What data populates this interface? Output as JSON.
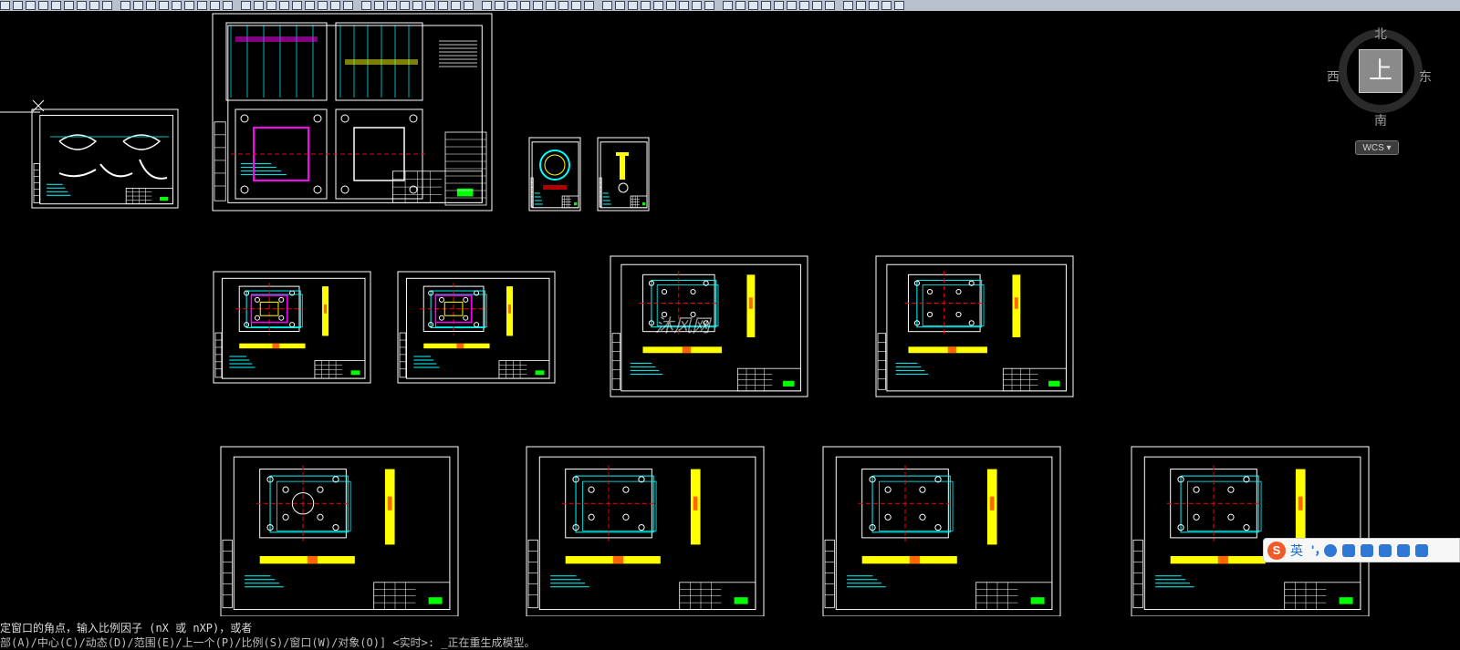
{
  "toolbar": {
    "icon_count": 68,
    "icon_names": [
      "line-icon",
      "polyline-icon",
      "polygon-icon",
      "rectangle-icon",
      "arc-icon",
      "circle-icon",
      "spline-icon",
      "ellipse-icon",
      "insert-block-icon",
      "hatch-icon",
      "text-icon",
      "move-icon",
      "copy-icon",
      "rotate-icon",
      "scale-icon",
      "trim-icon",
      "extend-icon",
      "fillet-icon",
      "layer-icon",
      "properties-icon",
      "zoom-icon",
      "pan-icon"
    ]
  },
  "viewcube": {
    "north": "北",
    "south": "南",
    "west": "西",
    "east": "东",
    "face": "上",
    "wcs_label": "WCS"
  },
  "command_line": {
    "line1": "定窗口的角点，输入比例因子 (nX 或 nXP)，或者",
    "line2": "部(A)/中心(C)/动态(D)/范围(E)/上一个(P)/比例(S)/窗口(W)/对象(O)] <实时>: _正在重生成模型。"
  },
  "ime": {
    "logo": "S",
    "lang": "英",
    "punct": "'，",
    "icons": [
      "emoji-icon",
      "microphone-icon",
      "keyboard-icon",
      "user-icon",
      "shirt-icon",
      "apps-icon"
    ]
  },
  "canvas": {
    "watermark": "沐风网",
    "colors": {
      "background": "#000000",
      "frame": "#ffffff",
      "cyan": "#00ffff",
      "yellow": "#ffff00",
      "red": "#ff0000",
      "green": "#00ff00",
      "magenta": "#ff00ff"
    }
  }
}
